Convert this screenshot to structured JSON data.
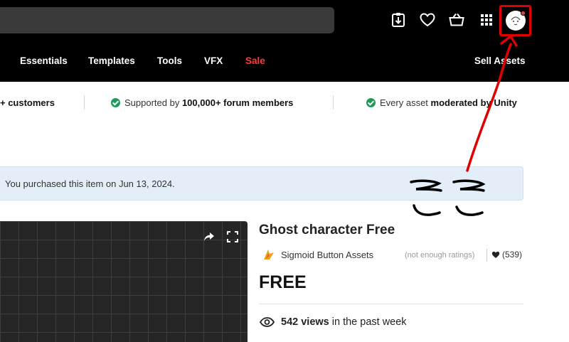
{
  "nav": {
    "items": [
      "Essentials",
      "Templates",
      "Tools",
      "VFX",
      "Sale"
    ],
    "sell_assets": "Sell Assets"
  },
  "trust": {
    "item1_bold": "+ customers",
    "item2_pre": "Supported by ",
    "item2_bold": "100,000+ forum members",
    "item3_pre": "Every asset ",
    "item3_bold": "moderated by Unity"
  },
  "banner": {
    "text": "You purchased this item on Jun 13, 2024."
  },
  "product": {
    "title": "Ghost character Free",
    "publisher": "Sigmoid Button Assets",
    "ratings": "(not enough ratings)",
    "likes": "(539)",
    "price": "FREE",
    "views_count": "542 views",
    "views_suffix": " in the past week"
  },
  "colors": {
    "header_bg": "#000000",
    "sale": "#ff3b3b",
    "check": "#1e9a5a",
    "banner_bg": "#e3eef8",
    "annotation": "#e00000"
  },
  "icons": [
    "download-icon",
    "heart-icon",
    "basket-icon",
    "apps-grid-icon",
    "avatar-icon",
    "share-icon",
    "fullscreen-icon",
    "check-circle-icon",
    "eye-icon",
    "publisher-logo-icon"
  ]
}
